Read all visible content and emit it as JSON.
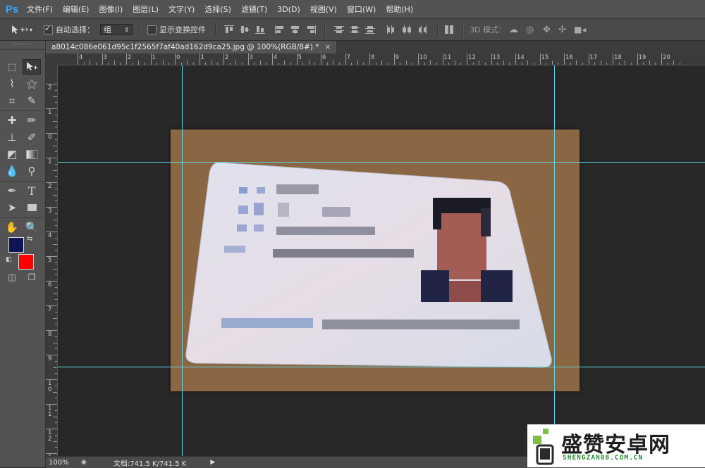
{
  "app": {
    "logo": "Ps"
  },
  "menu": [
    "文件(F)",
    "编辑(E)",
    "图像(I)",
    "图层(L)",
    "文字(Y)",
    "选择(S)",
    "滤镜(T)",
    "3D(D)",
    "视图(V)",
    "窗口(W)",
    "帮助(H)"
  ],
  "options": {
    "auto_select_label": "自动选择：",
    "auto_select_checked": true,
    "auto_select_value": "组",
    "show_transform_label": "显示变换控件",
    "show_transform_checked": false,
    "mode_3d_label": "3D 模式："
  },
  "document": {
    "tab_title": "a8014c086e061d95c1f2565f7af40ad162d9ca25.jpg @ 100%(RGB/8#) *",
    "close_glyph": "×"
  },
  "rulers": {
    "top_labels": [
      "4",
      "3",
      "2",
      "1",
      "0",
      "1",
      "2",
      "3",
      "4",
      "5",
      "6",
      "7",
      "8",
      "9",
      "10",
      "11",
      "12",
      "13",
      "14",
      "15",
      "16",
      "17",
      "18",
      "19",
      "20"
    ],
    "left_labels": [
      "2",
      "1",
      "0",
      "1",
      "2",
      "3",
      "4",
      "5",
      "6",
      "7",
      "8",
      "9",
      "10",
      "11",
      "12",
      "13"
    ]
  },
  "colors": {
    "foreground": "#0e1456",
    "background": "#ff0000",
    "photo_bg": "#8b6642",
    "guide": "#5fd5e6",
    "ps_blue": "#31a8ff"
  },
  "status": {
    "zoom": "100%",
    "doc_info": "文档:741.5 K/741.5 K",
    "arrow": "▶"
  },
  "watermark": {
    "brand": "盛赞安卓网",
    "url": "SHENGZAN08.COM.CN"
  }
}
